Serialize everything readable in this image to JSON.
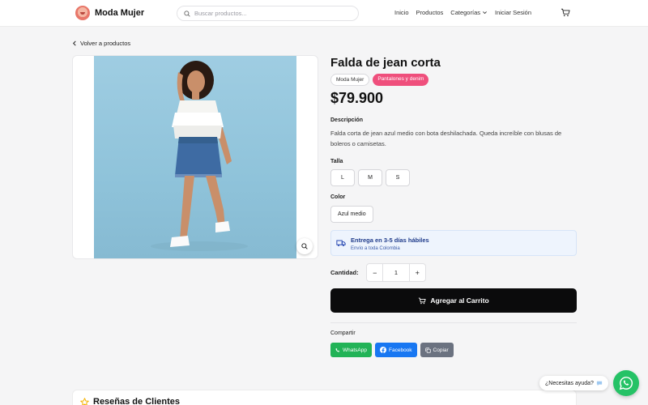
{
  "header": {
    "brand": "Moda Mujer",
    "search_placeholder": "Buscar productos...",
    "nav": {
      "inicio": "Inicio",
      "productos": "Productos",
      "categorias": "Categorías",
      "login": "Iniciar Sesión"
    }
  },
  "back_label": "Volver a productos",
  "product": {
    "title": "Falda de jean corta",
    "brand_tag": "Moda Mujer",
    "category_tag": "Pantalones y denim",
    "price": "$79.900",
    "description_label": "Descripción",
    "description": "Falda corta de jean azul medio con bota deshilachada. Queda increíble con blusas de boleros o camisetas.",
    "size_label": "Talla",
    "sizes": [
      "L",
      "M",
      "S"
    ],
    "color_label": "Color",
    "color": "Azul medio",
    "delivery_title": "Entrega en 3-5 días hábiles",
    "delivery_sub": "Envío a toda Colombia",
    "quantity_label": "Cantidad:",
    "quantity": "1",
    "qty_minus": "−",
    "qty_plus": "+",
    "add_to_cart": "Agregar al Carrito",
    "share_label": "Compartir",
    "share": {
      "whatsapp": "WhatsApp",
      "facebook": "Facebook",
      "copy": "Copiar"
    }
  },
  "reviews_title": "Reseñas de Clientes",
  "help_bubble": "¿Necesitas ayuda?",
  "colors": {
    "accent_pink": "#ef4f7c",
    "whatsapp_green": "#22b357",
    "facebook_blue": "#1877f2",
    "cta_black": "#0b0b0c"
  }
}
